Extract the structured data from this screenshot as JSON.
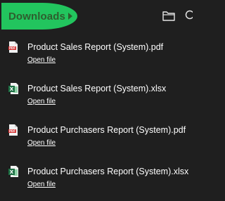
{
  "header": {
    "title": "Downloads"
  },
  "colors": {
    "background": "#1f1f1f",
    "highlight": "#22c55e",
    "title_text": "#2e5e2e",
    "pdf_red": "#d32f2f",
    "excel_green": "#1d7044"
  },
  "icons": {
    "folder": "folder-icon",
    "search": "search-icon",
    "pdf": "pdf-file-icon",
    "excel": "excel-file-icon"
  },
  "downloads": [
    {
      "name": "Product Sales Report (System).pdf",
      "type": "pdf",
      "action": "Open file"
    },
    {
      "name": "Product Sales Report (System).xlsx",
      "type": "xlsx",
      "action": "Open file"
    },
    {
      "name": "Product Purchasers Report (System).pdf",
      "type": "pdf",
      "action": "Open file"
    },
    {
      "name": "Product Purchasers Report (System).xlsx",
      "type": "xlsx",
      "action": "Open file"
    }
  ]
}
